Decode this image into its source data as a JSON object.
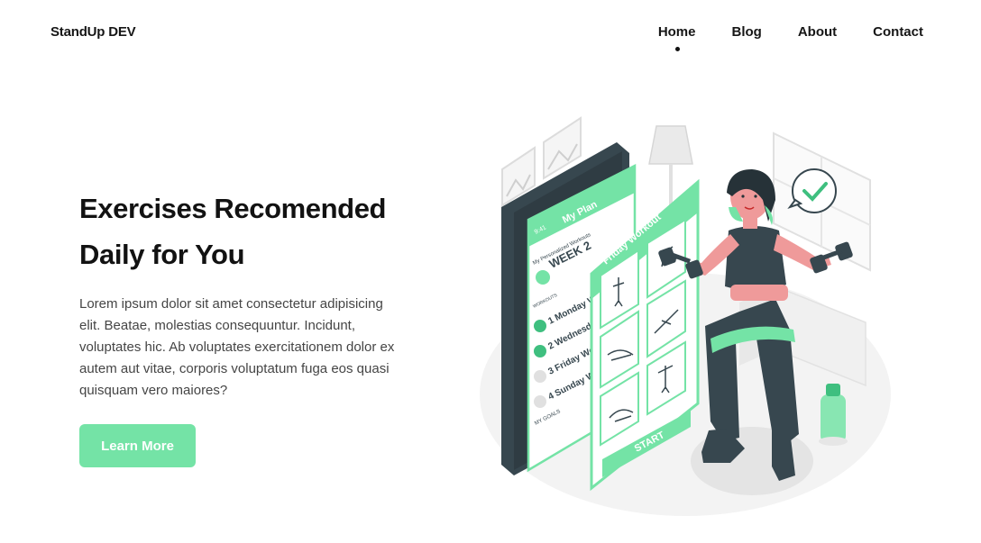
{
  "header": {
    "logo": "StandUp DEV",
    "nav": [
      {
        "label": "Home",
        "active": true
      },
      {
        "label": "Blog"
      },
      {
        "label": "About"
      },
      {
        "label": "Contact"
      }
    ]
  },
  "hero": {
    "title_line1": "Exercises Recomended",
    "title_line2": "Daily for You",
    "description": "Lorem ipsum dolor sit amet consectetur adipisicing elit. Beatae, molestias consequuntur. Incidunt, voluptates hic. Ab voluptates exercitationem dolor ex autem aut vitae, corporis voluptatum fuga eos quasi quisquam vero maiores?",
    "cta_label": "Learn More"
  },
  "illustration": {
    "phone": {
      "time": "9:41",
      "title": "My Plan",
      "subtitle": "My Personalized Workouts",
      "week": "WEEK 2",
      "section_workouts": "WORKOUTS",
      "items": [
        "1 Monday W",
        "2 Wednesd",
        "3 Friday Wo",
        "4 Sunday W"
      ],
      "section_goals": "MY GOALS"
    },
    "card": {
      "time": "9:41",
      "title": "Friday Workout",
      "start_label": "START"
    }
  },
  "colors": {
    "accent": "#74e3a6",
    "accent_dark": "#3fbf7f",
    "text": "#121212",
    "body_text": "#454545",
    "dark_gray": "#37474f"
  }
}
